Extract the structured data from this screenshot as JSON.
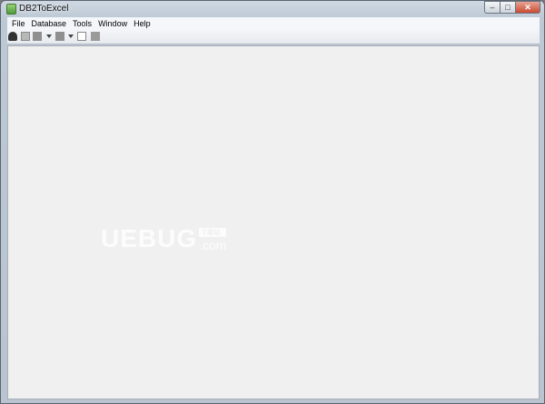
{
  "window": {
    "title": "DB2ToExcel",
    "controls": {
      "minimize": "–",
      "maximize": "□",
      "close": "✕"
    }
  },
  "menubar": {
    "items": [
      "File",
      "Database",
      "Tools",
      "Window",
      "Help"
    ]
  },
  "toolbar": {
    "icons": [
      "connect-icon",
      "new-document-icon",
      "database-icon",
      "dropdown-arrow-icon",
      "table-icon",
      "dropdown-arrow-icon",
      "sql-query-icon",
      "export-icon"
    ]
  },
  "watermark": {
    "main": "UEBUG",
    "badge": "下载站",
    "suffix": ".com"
  }
}
